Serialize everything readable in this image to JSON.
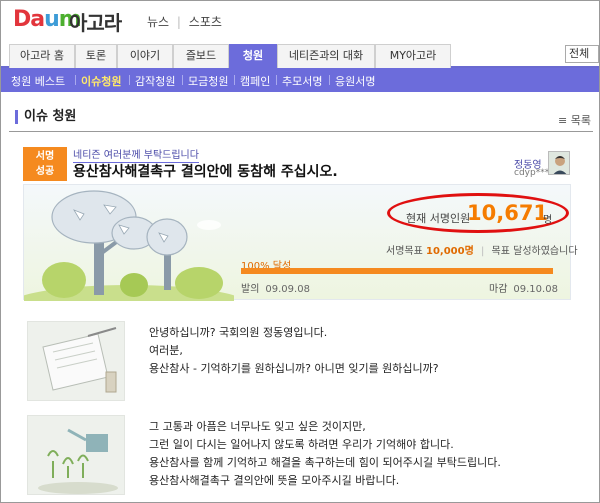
{
  "header": {
    "logo": {
      "d": "Da",
      "a": "u",
      "m": "m"
    },
    "site_name": "아고라",
    "links": [
      "뉴스",
      "스포츠"
    ]
  },
  "tabs": [
    {
      "label": "아고라 홈",
      "active": false
    },
    {
      "label": "토론",
      "active": false
    },
    {
      "label": "이야기",
      "active": false
    },
    {
      "label": "즐보드",
      "active": false
    },
    {
      "label": "청원",
      "active": true
    },
    {
      "label": "네티즌과의 대화",
      "active": false
    },
    {
      "label": "MY아고라",
      "active": false
    }
  ],
  "search": {
    "value": "전체"
  },
  "subnav": [
    {
      "label": "청원 베스트",
      "active": false
    },
    {
      "label": "이슈청원",
      "active": true
    },
    {
      "label": "감작청원",
      "active": false
    },
    {
      "label": "모금청원",
      "active": false
    },
    {
      "label": "캠페인",
      "active": false
    },
    {
      "label": "추모서명",
      "active": false
    },
    {
      "label": "응원서명",
      "active": false
    }
  ],
  "section": {
    "title": "이슈 청원",
    "list_label": "목록"
  },
  "petition": {
    "badge_line1": "서명",
    "badge_line2": "성공",
    "kicker": "네티즌 여러분께 부탁드립니다",
    "title": "용산참사해결촉구 결의안에 동참해 주십시오.",
    "author": "정동영",
    "author_id": "cdyp****",
    "signature_label": "현재 서명인원",
    "signature_count": "10,671",
    "signature_unit": "명",
    "goal_label": "서명목표",
    "goal_value": "10,000명",
    "goal_status": "목표 달성하였습니다",
    "progress_text": "100% 달성",
    "progress_fraction": 1.0,
    "start_label": "발의",
    "start_date": "09.09.08",
    "end_label": "마감",
    "end_date": "09.10.08"
  },
  "body": {
    "para1": [
      "안녕하십니까? 국회의원 정동영입니다.",
      "",
      "여러분,",
      "용산참사 - 기억하기를 원하십니까? 아니면 잊기를 원하십니까?"
    ],
    "para2": [
      "그 고통과 아픔은 너무나도 잊고 싶은 것이지만,",
      "그런 일이 다시는 일어나지 않도록 하려면 우리가 기억해야 합니다.",
      "용산참사를 함께 기억하고 해결을 촉구하는데 힘이 되어주시길 부탁드립니다.",
      "용산참사해결촉구 결의안에 뜻을 모아주시길 바랍니다."
    ]
  },
  "colors": {
    "accent": "#6c6cdb",
    "badge": "#f58a1f",
    "count": "#f57c00",
    "highlight": "#e01010"
  }
}
